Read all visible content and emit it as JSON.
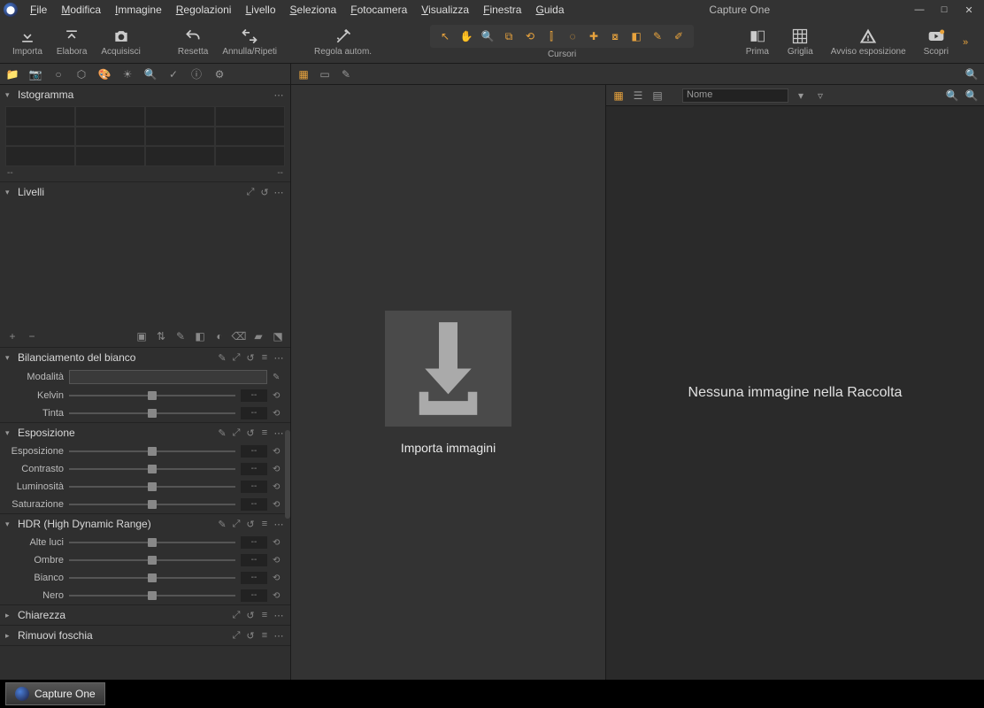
{
  "app": {
    "title": "Capture One",
    "taskbar_label": "Capture One"
  },
  "menu": [
    "File",
    "Modifica",
    "Immagine",
    "Regolazioni",
    "Livello",
    "Seleziona",
    "Fotocamera",
    "Visualizza",
    "Finestra",
    "Guida"
  ],
  "toolbar_left": [
    {
      "name": "importa",
      "label": "Importa",
      "icon": "download"
    },
    {
      "name": "elabora",
      "label": "Elabora",
      "icon": "upload"
    },
    {
      "name": "acquisisci",
      "label": "Acquisisci",
      "icon": "camera"
    }
  ],
  "toolbar_mid": [
    {
      "name": "resetta",
      "label": "Resetta",
      "icon": "undo-all"
    },
    {
      "name": "annulla-ripeti",
      "label": "Annulla/Ripeti",
      "icon": "undo-redo"
    }
  ],
  "toolbar_adj": {
    "name": "regola-autom",
    "label": "Regola autom.",
    "icon": "wand"
  },
  "cursor_label": "Cursori",
  "cursor_icons": [
    "pointer",
    "hand",
    "zoom",
    "crop",
    "rotate",
    "keystone",
    "spot",
    "healing",
    "clone",
    "erase",
    "mask-draw",
    "mask-erase"
  ],
  "toolbar_right": [
    {
      "name": "prima",
      "label": "Prima",
      "icon": "before"
    },
    {
      "name": "griglia",
      "label": "Griglia",
      "icon": "grid"
    },
    {
      "name": "avviso-esposizione",
      "label": "Avviso esposizione",
      "icon": "warning"
    },
    {
      "name": "scopri",
      "label": "Scopri",
      "icon": "play"
    }
  ],
  "tool_tabs": [
    "library",
    "capture",
    "lens",
    "crop",
    "color",
    "exposure",
    "details",
    "adjust",
    "metadata",
    "settings"
  ],
  "panels": {
    "histogram": {
      "title": "Istogramma",
      "left": "--",
      "right": "--"
    },
    "levels": {
      "title": "Livelli"
    },
    "white_balance": {
      "title": "Bilanciamento del bianco",
      "mode_label": "Modalità",
      "sliders": [
        {
          "label": "Kelvin",
          "val": "--"
        },
        {
          "label": "Tinta",
          "val": "--"
        }
      ]
    },
    "exposure": {
      "title": "Esposizione",
      "sliders": [
        {
          "label": "Esposizione",
          "val": "--"
        },
        {
          "label": "Contrasto",
          "val": "--"
        },
        {
          "label": "Luminosità",
          "val": "--"
        },
        {
          "label": "Saturazione",
          "val": "--"
        }
      ]
    },
    "hdr": {
      "title": "HDR (High Dynamic Range)",
      "sliders": [
        {
          "label": "Alte luci",
          "val": "--"
        },
        {
          "label": "Ombre",
          "val": "--"
        },
        {
          "label": "Bianco",
          "val": "--"
        },
        {
          "label": "Nero",
          "val": "--"
        }
      ]
    },
    "clarity": {
      "title": "Chiarezza"
    },
    "dehaze": {
      "title": "Rimuovi foschia"
    }
  },
  "viewer": {
    "import_label": "Importa immagini"
  },
  "browser": {
    "sort": "Nome",
    "empty": "Nessuna immagine nella Raccolta"
  }
}
